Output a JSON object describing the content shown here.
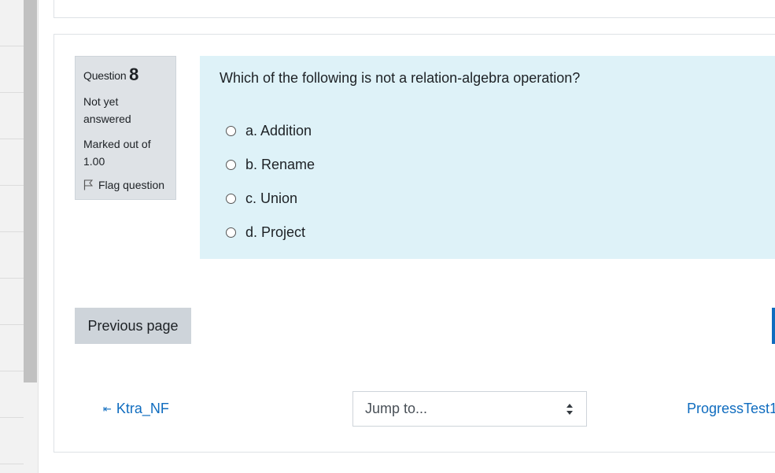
{
  "question": {
    "label": "Question",
    "number": "8",
    "state": "Not yet answered",
    "grade": "Marked out of 1.00",
    "flag_label": "Flag question",
    "text": "Which of the following is not a relation-algebra operation?",
    "options": [
      {
        "label": "a. Addition",
        "selected": false
      },
      {
        "label": "b. Rename",
        "selected": false
      },
      {
        "label": "c. Union",
        "selected": false
      },
      {
        "label": "d. Project",
        "selected": false
      }
    ]
  },
  "navigation": {
    "previous_page_label": "Previous page",
    "prev_activity_label": "Ktra_NF",
    "jump_placeholder": "Jump to...",
    "next_activity_label": "ProgressTest1"
  },
  "colors": {
    "link": "#0f6cbf",
    "formulation_bg": "#def2f8",
    "info_bg": "#dee2e6",
    "secondary_button": "#ced4da"
  },
  "icons": {
    "flag": "flag-outline-icon",
    "prev_arrow": "left-arrow-icon",
    "select_caret": "up-down-caret-icon"
  }
}
